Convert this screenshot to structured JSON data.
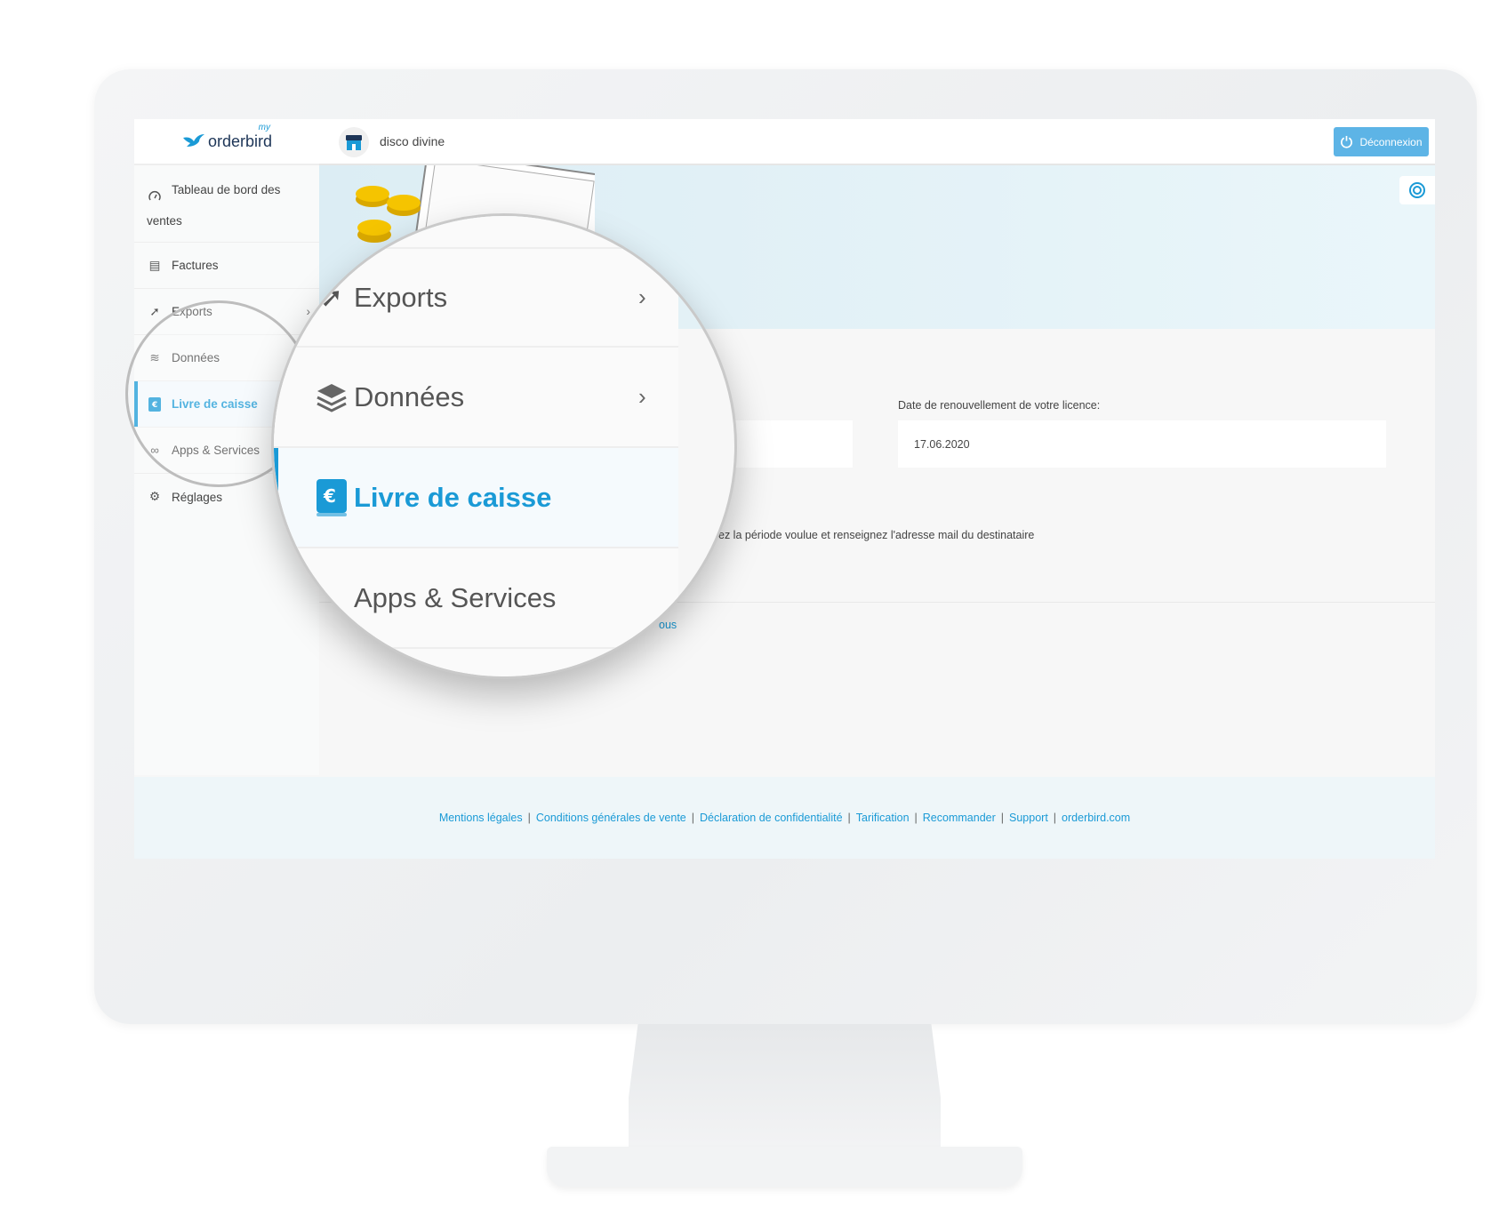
{
  "brand": {
    "logo_text": "orderbird",
    "logo_prefix": "my",
    "accent": "#1a9ad6"
  },
  "header": {
    "venue_name": "disco divine",
    "logout_label": "Déconnexion"
  },
  "sidebar": {
    "items": [
      {
        "label": "Tableau de bord des ventes",
        "icon": "gauge-icon"
      },
      {
        "label": "Factures",
        "icon": "receipt-icon"
      },
      {
        "label": "Exports",
        "icon": "export-icon"
      },
      {
        "label": "Données",
        "icon": "layers-icon"
      },
      {
        "label": "Livre de caisse",
        "icon": "cashbook-icon",
        "active": true
      },
      {
        "label": "Apps & Services",
        "icon": "apps-icon"
      },
      {
        "label": "Réglages",
        "icon": "gear-icon"
      }
    ]
  },
  "magnifier": {
    "items": [
      {
        "label": "Exports"
      },
      {
        "label": "Données"
      },
      {
        "label": "Livre de caisse"
      },
      {
        "label": "Apps & Services"
      }
    ]
  },
  "main": {
    "license_label": "Date de renouvellement de votre licence:",
    "license_date": "17.06.2020",
    "instruction_fragment": "ez la période voulue et renseignez l'adresse mail du destinataire",
    "link_fragment": "ous"
  },
  "footer": {
    "links": [
      "Mentions légales",
      "Conditions générales de vente",
      "Déclaration de confidentialité",
      "Tarification",
      "Recommander",
      "Support",
      "orderbird.com"
    ]
  }
}
